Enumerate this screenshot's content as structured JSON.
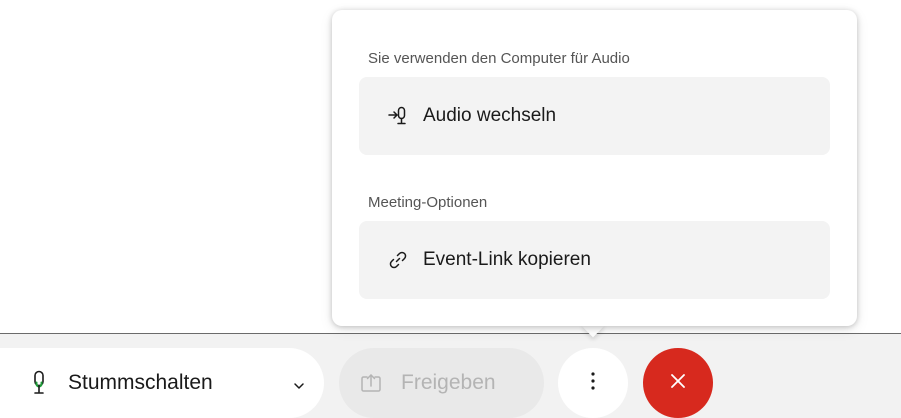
{
  "popup": {
    "audio_section": {
      "heading": "Sie verwenden den Computer für Audio",
      "item": {
        "label": "Audio wechseln",
        "icon": "switch-audio-icon"
      }
    },
    "meeting_section": {
      "heading": "Meeting-Optionen",
      "item": {
        "label": "Event-Link kopieren",
        "icon": "link-icon"
      }
    }
  },
  "controls": {
    "mute": {
      "label": "Stummschalten",
      "icon": "microphone-icon",
      "dropdown_icon": "chevron-down-icon",
      "mic_level_color": "#1f9e3a"
    },
    "share": {
      "label": "Freigeben",
      "icon": "share-screen-icon",
      "disabled": true
    },
    "more": {
      "icon": "more-vertical-icon"
    },
    "end": {
      "icon": "close-icon",
      "color": "#d7291e"
    }
  }
}
